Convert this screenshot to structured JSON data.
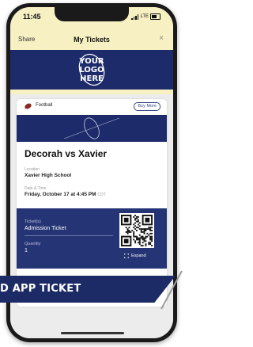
{
  "status_bar": {
    "time": "11:45",
    "network": "LTE"
  },
  "nav": {
    "share_label": "Share",
    "title": "My Tickets",
    "close_glyph": "×"
  },
  "banner": {
    "logo_lines": [
      "YOUR",
      "LOGO",
      "HERE"
    ]
  },
  "ticket_card": {
    "sport": "Football",
    "buy_more_label": "Buy More",
    "matchup": "Decorah vs Xavier",
    "location_label": "Location",
    "location_value": "Xavier High School",
    "datetime_label": "Date & Time",
    "datetime_value": "Friday, October 17 at 4:45 PM",
    "timezone": "CDT",
    "tickets_label": "Ticket(s)",
    "tickets_value": "Admission Ticket",
    "quantity_label": "Quantity",
    "quantity_value": "1",
    "expand_label": "Expand"
  },
  "overlay": {
    "caption": "D APP TICKET"
  },
  "colors": {
    "navy": "#1d2b6b",
    "cream": "#f7f0c2",
    "football": "#8a2b22"
  },
  "icons": [
    "signal-bars-icon",
    "battery-icon",
    "close-icon",
    "football-icon",
    "qr-code-icon",
    "expand-icon"
  ]
}
